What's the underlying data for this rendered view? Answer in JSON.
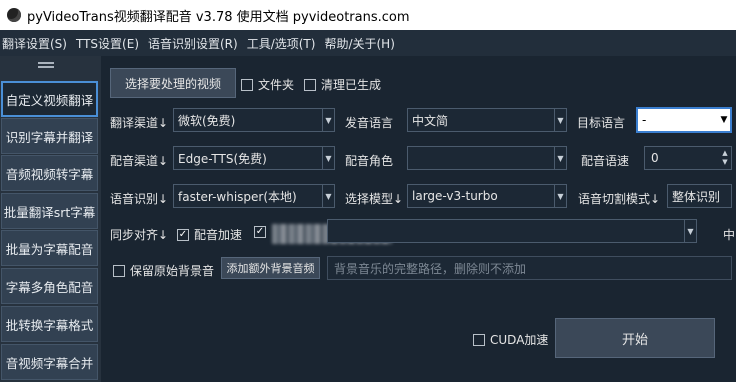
{
  "titlebar": {
    "title": "pyVideoTrans视频翻译配音 v3.78  使用文档  pyvideotrans.com"
  },
  "menubar": {
    "items": [
      "翻译设置(S)",
      "TTS设置(E)",
      "语音识别设置(R)",
      "工具/选项(T)",
      "帮助/关于(H)"
    ]
  },
  "sidebar": {
    "items": [
      {
        "label": "自定义视频翻译",
        "active": true
      },
      {
        "label": "识别字幕并翻译"
      },
      {
        "label": "音频视频转字幕"
      },
      {
        "label": "批量翻译srt字幕"
      },
      {
        "label": "批量为字幕配音"
      },
      {
        "label": "字幕多角色配音"
      },
      {
        "label": "批转换字幕格式"
      },
      {
        "label": "音视频字幕合并"
      }
    ]
  },
  "main": {
    "select_video_btn": "选择要处理的视频",
    "folder_checkbox": "文件夹",
    "clear_generated_checkbox": "清理已生成",
    "translate_channel_label": "翻译渠道↓",
    "translate_channel_value": "微软(免费)",
    "source_lang_label": "发音语言",
    "source_lang_value": "中文简",
    "target_lang_label": "目标语言",
    "target_lang_value": "-",
    "tts_channel_label": "配音渠道↓",
    "tts_channel_value": "Edge-TTS(免费)",
    "voice_role_label": "配音角色",
    "voice_role_value": "",
    "speech_rate_label": "配音语速",
    "speech_rate_value": "0",
    "asr_label": "语音识别↓",
    "asr_value": "faster-whisper(本地)",
    "model_label": "选择模型↓",
    "model_value": "large-v3-turbo",
    "split_mode_label": "语音切割模式↓",
    "split_mode_value": "整体识别",
    "sync_label": "同步对齐↓",
    "tts_speedup_checkbox": "配音加速",
    "trailing_char": "中",
    "keep_bgm_checkbox": "保留原始背景音",
    "add_bgm_btn": "添加额外背景音频",
    "bgm_path_placeholder": "背景音乐的完整路径，删除则不添加",
    "cuda_checkbox": "CUDA加速",
    "start_btn": "开始"
  },
  "colors": {
    "accent": "#4a8fd6",
    "background": "#1a2531",
    "sidebar_button": "#324152"
  }
}
